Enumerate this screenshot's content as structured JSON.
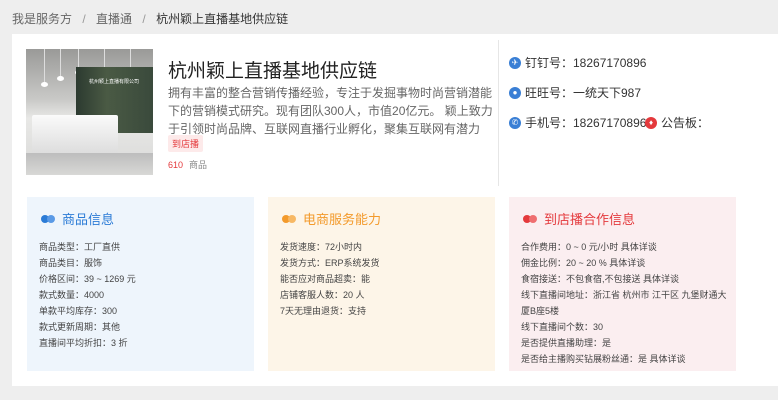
{
  "breadcrumb": [
    "我是服务方",
    "直播通",
    "杭州颖上直播基地供应链"
  ],
  "supplier": {
    "name": "杭州颖上直播基地供应链",
    "description": "拥有丰富的整合营销传播经验，专注于发掘事物时尚营销潜能下的营销模式研究。现有团队300人，市值20亿元。 颖上致力于引领时尚品牌、互联网直播行业孵化，聚集互联网有潜力的...",
    "tag": "到店播",
    "product_count": "610",
    "product_unit": "商品",
    "photo_sign": "杭州颖上直播有限公司"
  },
  "contacts": {
    "dingding": "钉钉号：18267170896",
    "wangwang": "旺旺号：一统天下987",
    "phone": "手机号：18267170896",
    "notice": "公告板："
  },
  "panels": {
    "product": {
      "title": "商品信息",
      "rows": [
        "商品类型：工厂直供",
        "商品类目：服饰",
        "价格区间：39 ~ 1269 元",
        "款式数量：4000",
        "单款平均库存：300",
        "款式更新周期：其他",
        "直播间平均折扣：3 折"
      ]
    },
    "ecommerce": {
      "title": "电商服务能力",
      "rows": [
        "发货速度：72小时内",
        "发货方式：ERP系统发货",
        "能否应对商品超卖：能",
        "店铺客服人数：20 人",
        "7天无理由退货：支持"
      ]
    },
    "instore": {
      "title": "到店播合作信息",
      "rows": [
        "合作费用：0 ~ 0 元/小时 具体详谈",
        "佣金比例：20 ~ 20 % 具体详谈",
        "食宿接送：不包食宿,不包接送 具体详谈",
        "线下直播间地址：浙江省 杭州市 江干区 九堡财通大厦B座5楼",
        "线下直播间个数：30",
        "是否提供直播助理：是",
        "是否给主播购买钻展粉丝通：是 具体详谈"
      ]
    }
  },
  "colors": {
    "product_accent": "#2b7bd6",
    "ecommerce_accent": "#f39a2b",
    "instore_accent": "#e4393c",
    "icon_blue": "#3a7fd5",
    "icon_red": "#e4393c"
  }
}
